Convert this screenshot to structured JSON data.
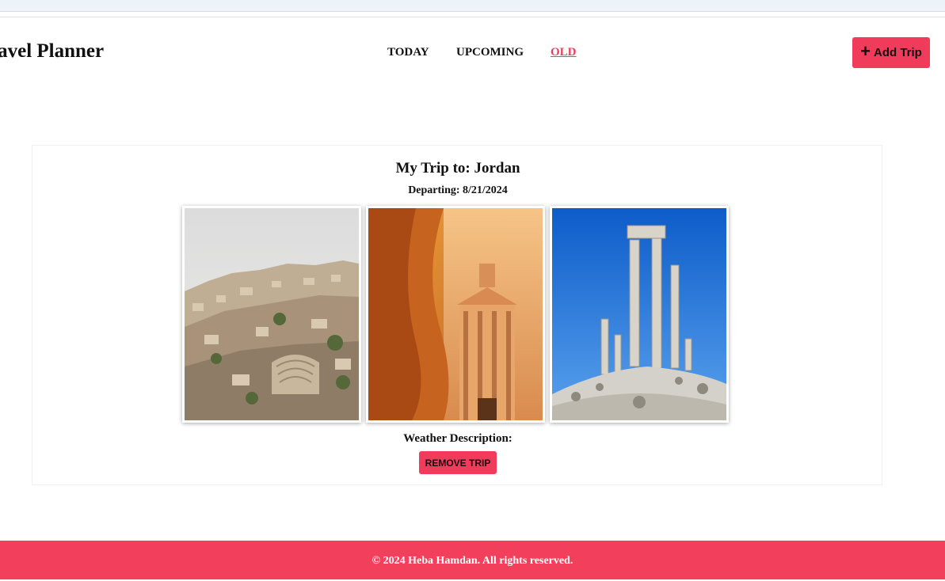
{
  "header": {
    "brand": "ravel Planner",
    "nav": [
      {
        "label": "TODAY",
        "active": false
      },
      {
        "label": "UPCOMING",
        "active": false
      },
      {
        "label": "OLD",
        "active": true
      }
    ],
    "add_trip_label": "Add Trip",
    "add_trip_icon": "plus-icon"
  },
  "trip": {
    "title": "My Trip to: Jordan",
    "departing": "Departing: 8/21/2024",
    "photos": [
      "amman-city-photo",
      "petra-treasury-photo",
      "temple-of-hercules-photo"
    ],
    "weather_label": "Weather Description:",
    "remove_label": "REMOVE TRIP"
  },
  "footer": {
    "text": "© 2024 Heba Hamdan. All rights reserved."
  },
  "colors": {
    "accent": "#f13b5a",
    "footer": "#f2405c"
  }
}
